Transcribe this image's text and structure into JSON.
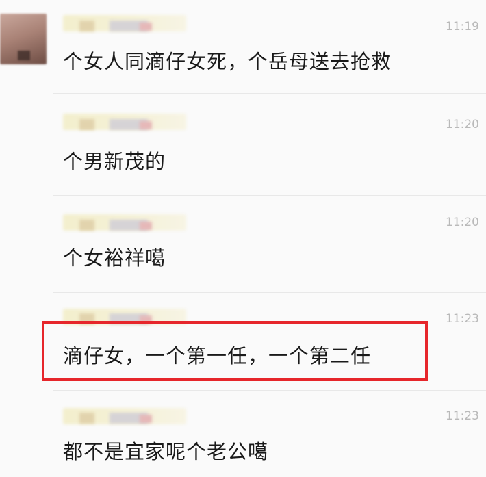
{
  "messages": [
    {
      "time": "11:19",
      "text": "个女人同滴仔女死，个岳母送去抢救"
    },
    {
      "time": "11:20",
      "text": "个男新茂的"
    },
    {
      "time": "11:20",
      "text": "个女裕祥噶"
    },
    {
      "time": "11:23",
      "text": "滴仔女，一个第一任，一个第二任"
    },
    {
      "time": "11:23",
      "text": "都不是宜家呢个老公噶"
    }
  ],
  "highlight_color": "#e6262b"
}
